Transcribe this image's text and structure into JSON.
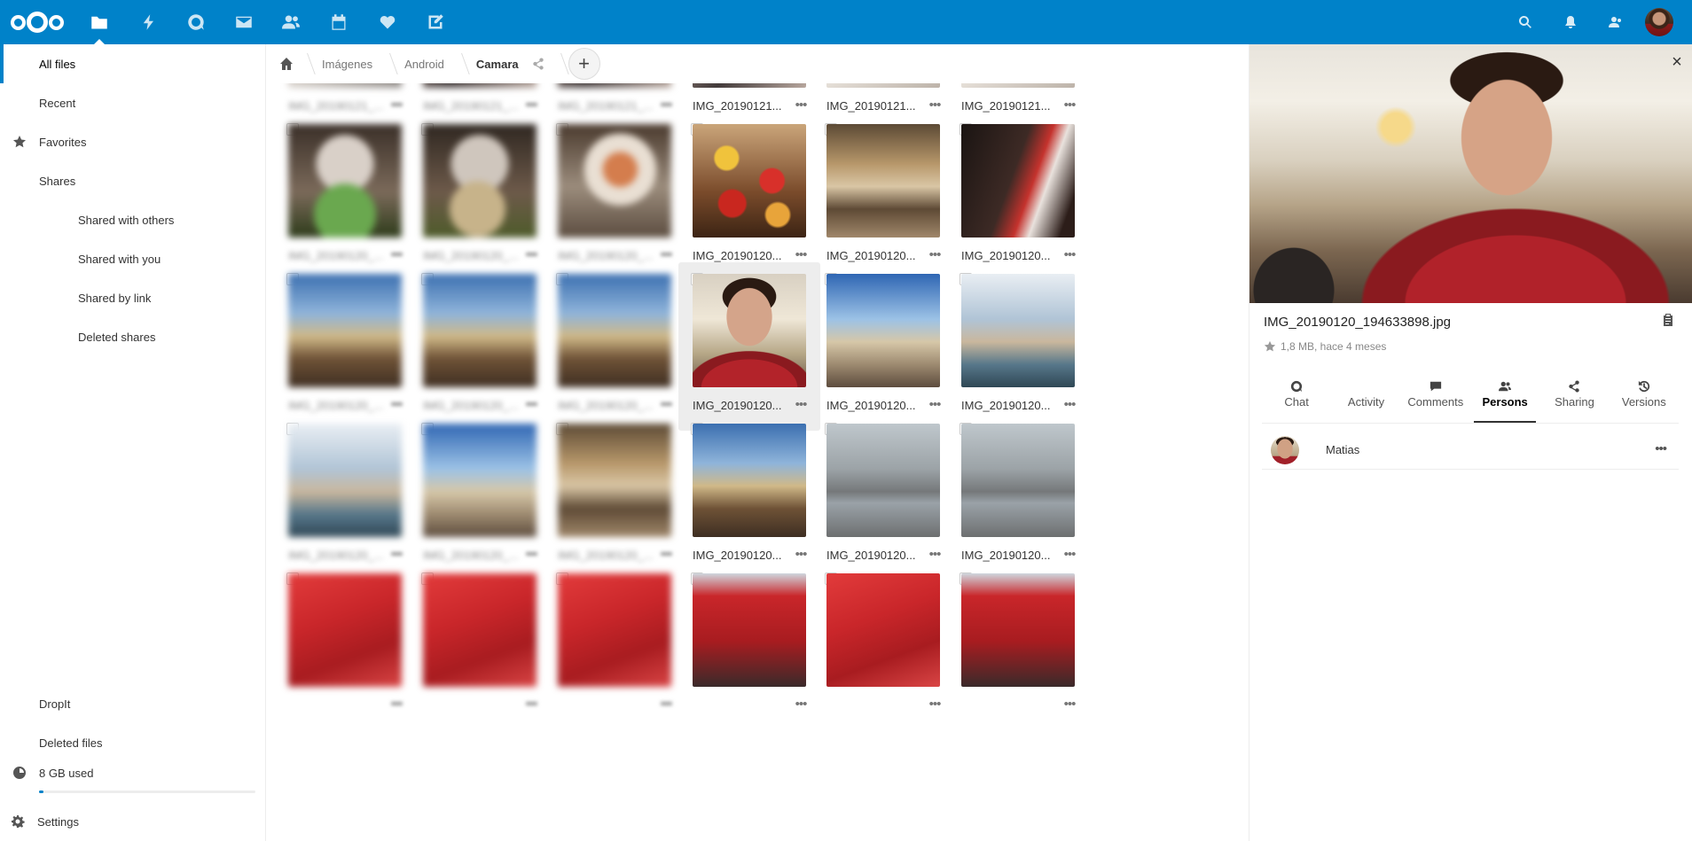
{
  "header": {
    "apps": [
      "files-icon",
      "activity-icon",
      "talk-icon",
      "mail-icon",
      "contacts-icon",
      "calendar-icon",
      "favorites-icon",
      "notes-icon"
    ],
    "right": [
      "search-icon",
      "notifications-icon",
      "contacts-menu-icon"
    ]
  },
  "sidebar": {
    "all_files": "All files",
    "recent": "Recent",
    "favorites": "Favorites",
    "shares": "Shares",
    "shared_with_others": "Shared with others",
    "shared_with_you": "Shared with you",
    "shared_by_link": "Shared by link",
    "deleted_shares": "Deleted shares",
    "dropit": "DropIt",
    "deleted_files": "Deleted files",
    "quota": "8 GB used",
    "quota_fraction": 0.02,
    "settings": "Settings"
  },
  "breadcrumb": {
    "items": [
      "Imágenes",
      "Android",
      "Camara"
    ],
    "add_label": "+"
  },
  "grid": {
    "rows": [
      {
        "tiles": [
          {
            "name": "IMG_20190121_...",
            "blur": true,
            "pattern": "p-gray"
          },
          {
            "name": "IMG_20190121_...",
            "blur": true,
            "pattern": "p-dark"
          },
          {
            "name": "IMG_20190121_...",
            "blur": true,
            "pattern": "p-dark"
          },
          {
            "name": "IMG_20190121...",
            "blur": false,
            "pattern": "p-dark"
          },
          {
            "name": "IMG_20190121...",
            "blur": false,
            "pattern": "p-floor"
          },
          {
            "name": "IMG_20190121...",
            "blur": false,
            "pattern": "p-floor"
          }
        ]
      },
      {
        "tiles": [
          {
            "name": "IMG_20190120_...",
            "blur": true,
            "pattern": "p-food1"
          },
          {
            "name": "IMG_20190120_...",
            "blur": true,
            "pattern": "p-food2"
          },
          {
            "name": "IMG_20190120_...",
            "blur": true,
            "pattern": "p-food3"
          },
          {
            "name": "IMG_20190120...",
            "blur": false,
            "pattern": "p-lant"
          },
          {
            "name": "IMG_20190120...",
            "blur": false,
            "pattern": "p-mall"
          },
          {
            "name": "IMG_20190120...",
            "blur": false,
            "pattern": "p-redblur"
          }
        ]
      },
      {
        "tiles": [
          {
            "name": "IMG_20190120_...",
            "blur": true,
            "pattern": "p-sky"
          },
          {
            "name": "IMG_20190120_...",
            "blur": true,
            "pattern": "p-sky"
          },
          {
            "name": "IMG_20190120_...",
            "blur": true,
            "pattern": "p-sky"
          },
          {
            "name": "IMG_20190120...",
            "blur": false,
            "pattern": "p-selfie",
            "selected": true
          },
          {
            "name": "IMG_20190120...",
            "blur": false,
            "pattern": "p-sky2"
          },
          {
            "name": "IMG_20190120...",
            "blur": false,
            "pattern": "p-canal"
          }
        ]
      },
      {
        "tiles": [
          {
            "name": "IMG_20190120_...",
            "blur": true,
            "pattern": "p-canal"
          },
          {
            "name": "IMG_20190120_...",
            "blur": true,
            "pattern": "p-sky2"
          },
          {
            "name": "IMG_20190120_...",
            "blur": true,
            "pattern": "p-mall"
          },
          {
            "name": "IMG_20190120...",
            "blur": false,
            "pattern": "p-sky"
          },
          {
            "name": "IMG_20190120...",
            "blur": false,
            "pattern": "p-vegas"
          },
          {
            "name": "IMG_20190120...",
            "blur": false,
            "pattern": "p-vegas"
          }
        ]
      },
      {
        "tiles": [
          {
            "name": "",
            "blur": true,
            "pattern": "p-car"
          },
          {
            "name": "",
            "blur": true,
            "pattern": "p-car"
          },
          {
            "name": "",
            "blur": true,
            "pattern": "p-car"
          },
          {
            "name": "",
            "blur": false,
            "pattern": "p-car2"
          },
          {
            "name": "",
            "blur": false,
            "pattern": "p-car"
          },
          {
            "name": "",
            "blur": false,
            "pattern": "p-car2"
          }
        ]
      }
    ]
  },
  "details": {
    "filename": "IMG_20190120_194633898.jpg",
    "meta": "1,8 MB, hace 4 meses",
    "tabs": [
      "Chat",
      "Activity",
      "Comments",
      "Persons",
      "Sharing",
      "Versions"
    ],
    "active_tab": "Persons",
    "person": "Matias"
  }
}
